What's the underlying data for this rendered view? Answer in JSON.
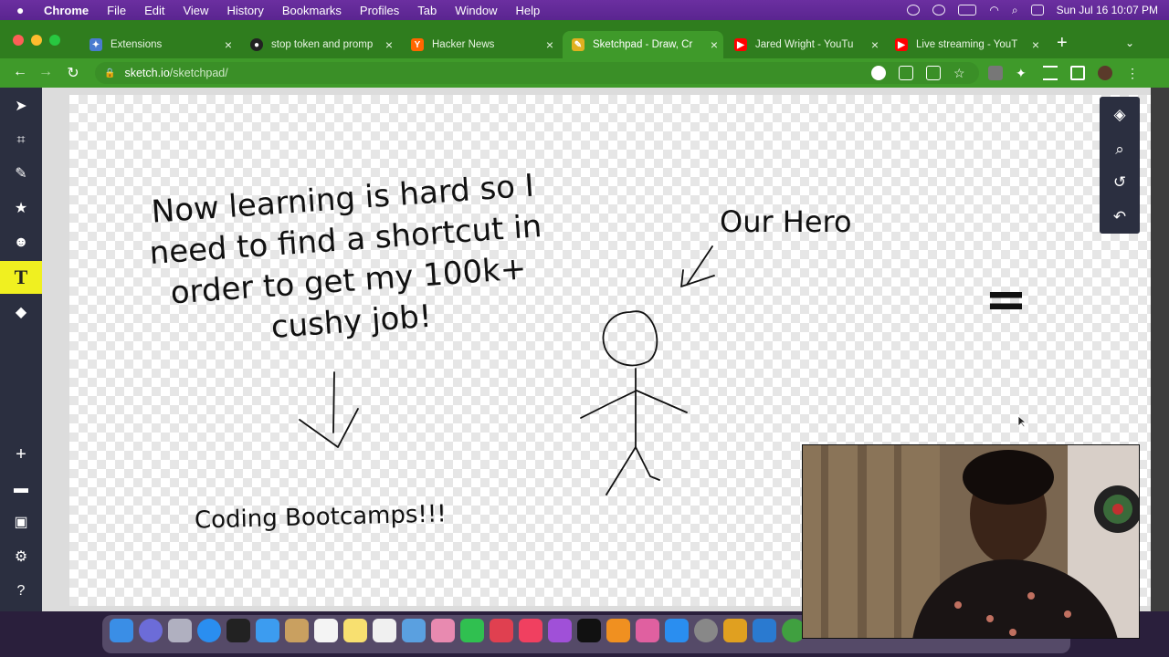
{
  "menubar": {
    "app": "Chrome",
    "items": [
      "File",
      "Edit",
      "View",
      "History",
      "Bookmarks",
      "Profiles",
      "Tab",
      "Window",
      "Help"
    ],
    "clock": "Sun Jul 16  10:07 PM"
  },
  "tabs": [
    {
      "title": "Extensions",
      "favicon": "puzzle-icon",
      "color": "#4a7bd0"
    },
    {
      "title": "stop token and promp",
      "favicon": "github-icon",
      "color": "#222222"
    },
    {
      "title": "Hacker News",
      "favicon": "Y",
      "color": "#ff6600"
    },
    {
      "title": "Sketchpad - Draw, Cr",
      "favicon": "sketchpad-icon",
      "color": "#e0b020",
      "active": true
    },
    {
      "title": "Jared Wright - YouTu",
      "favicon": "youtube-icon",
      "color": "#ff0000"
    },
    {
      "title": "Live streaming - YouT",
      "favicon": "youtube-icon",
      "color": "#ff0000"
    }
  ],
  "address": {
    "host": "sketch.io",
    "path": "/sketchpad/"
  },
  "left_tools": [
    "pointer-icon",
    "crop-icon",
    "brush-icon",
    "star-icon",
    "emoji-icon",
    "text-icon",
    "fill-icon",
    "add-icon",
    "folder-icon",
    "save-icon",
    "settings-icon",
    "help-icon"
  ],
  "active_tool": "T",
  "right_tools": [
    "layers-icon",
    "zoom-icon",
    "history-icon",
    "undo-icon"
  ],
  "canvas": {
    "main_text": [
      "Now learning is hard so I",
      "need to find a shortcut in",
      "order to get my 100k+",
      "cushy job!"
    ],
    "hero_label": "Our Hero",
    "bootcamp_label": "Coding Bootcamps!!!",
    "equals": "="
  },
  "colors": {
    "menubar": "#5a2590",
    "chrome_green": "#3f9a2a",
    "tool_active": "#f0f020"
  }
}
